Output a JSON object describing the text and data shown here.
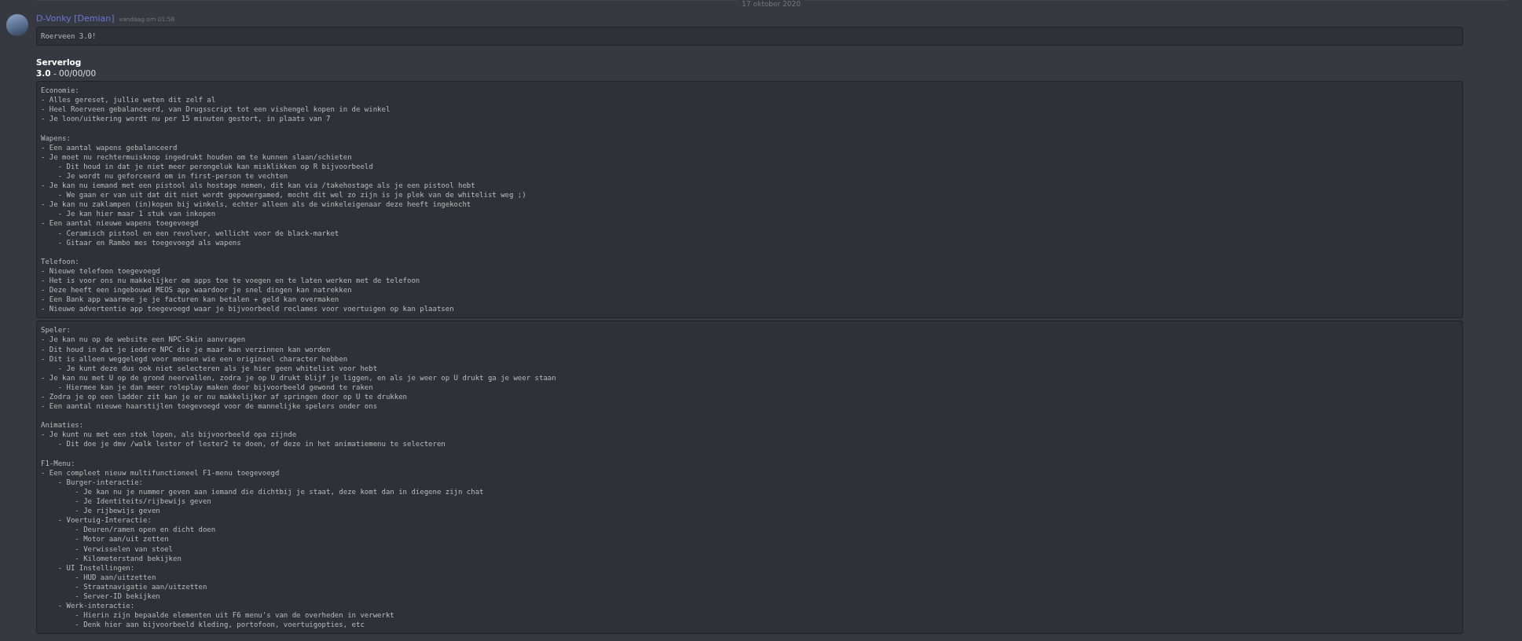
{
  "date_divider": "17 oktober 2020",
  "message": {
    "author": "D-Vonky [Demian]",
    "timestamp": "vandaag om 01:58",
    "content": [
      {
        "kind": "code",
        "groups": [
          [
            "Roerveen 3.0!"
          ]
        ]
      },
      {
        "kind": "heading",
        "text": "Serverlog"
      },
      {
        "kind": "text",
        "text": "**3.0** - 00/00/00"
      },
      {
        "kind": "code",
        "groups": [
          [
            "Economie:",
            "- Alles gereset, jullie weten dit zelf al",
            "- Heel Roerveen gebalanceerd, van Drugsscript tot een vishengel kopen in de winkel",
            "- Je loon/uitkering wordt nu per 15 minuten gestort, in plaats van 7"
          ],
          [
            "Wapens:",
            "- Een aantal wapens gebalanceerd",
            "- Je moet nu rechtermuisknop ingedrukt houden om te kunnen slaan/schieten",
            "    - Dit houd in dat je niet meer perongeluk kan misklikken op R bijvoorbeeld",
            "    - Je wordt nu geforceerd om in first-person te vechten",
            "- Je kan nu iemand met een pistool als hostage nemen, dit kan via /takehostage als je een pistool hebt",
            "    - We gaan er van uit dat dit niet wordt gepowergamed, mocht dit wel zo zijn is je plek van de whitelist weg ;)",
            "- Je kan nu zaklampen (in)kopen bij winkels, echter alleen als de winkeleigenaar deze heeft ingekocht",
            "    - Je kan hier maar 1 stuk van inkopen",
            "- Een aantal nieuwe wapens toegevoegd",
            "    - Ceramisch pistool en een revolver, wellicht voor de black-market",
            "    - Gitaar en Rambo mes toegevoegd als wapens"
          ],
          [
            "Telefoon:",
            "- Nieuwe telefoon toegevoegd",
            "- Het is voor ons nu makkelijker om apps toe te voegen en te laten werken met de telefoon",
            "- Deze heeft een ingebouwd MEOS app waardoor je snel dingen kan natrekken",
            "- Een Bank app waarmee je je facturen kan betalen + geld kan overmaken",
            "- Nieuwe advertentie app toegevoegd waar je bijvoorbeeld reclames voor voertuigen op kan plaatsen"
          ]
        ]
      },
      {
        "kind": "code",
        "groups": [
          [
            "Speler:",
            "- Je kan nu op de website een NPC-Skin aanvragen",
            "- Dit houd in dat je iedere NPC die je maar kan verzinnen kan worden",
            "- Dit is alleen weggelegd voor mensen wie een origineel character hebben",
            "    - Je kunt deze dus ook niet selecteren als je hier geen whitelist voor hebt",
            "- Je kan nu met U op de grond neervallen, zodra je op U drukt blijf je liggen, en als je weer op U drukt ga je weer staan",
            "    - Hiermee kan je dan meer roleplay maken door bijvoorbeeld gewond te raken",
            "- Zodra je op een ladder zit kan je er nu makkelijker af springen door op U te drukken",
            "- Een aantal nieuwe haarstijlen toegevoegd voor de mannelijke spelers onder ons"
          ],
          [
            "Animaties:",
            "- Je kunt nu met een stok lopen, als bijvoorbeeld opa zijnde",
            "    - Dit doe je dmv /walk lester of lester2 te doen, of deze in het animatiemenu te selecteren"
          ],
          [
            "F1-Menu:",
            "- Een compleet nieuw multifunctioneel F1-menu toegevoegd",
            "    - Burger-interactie:",
            "        - Je kan nu je nummer geven aan iemand die dichtbij je staat, deze komt dan in diegene zijn chat",
            "        - Je Identiteits/rijbewijs geven",
            "        - Je rijbewijs geven",
            "    - Voertuig-Interactie:",
            "        - Deuren/ramen open en dicht doen",
            "        - Motor aan/uit zetten",
            "        - Verwisselen van stoel",
            "        - Kilometerstand bekijken",
            "    - UI Instellingen:",
            "        - HUD aan/uitzetten",
            "        - Straatnavigatie aan/uitzetten",
            "        - Server-ID bekijken",
            "    - Werk-interactie:",
            "        - Hierin zijn bepaalde elementen uit F6 menu's van de overheden in verwerkt",
            "        - Denk hier aan bijvoorbeeld kleding, portofoon, voertuigopties, etc"
          ]
        ]
      }
    ]
  }
}
